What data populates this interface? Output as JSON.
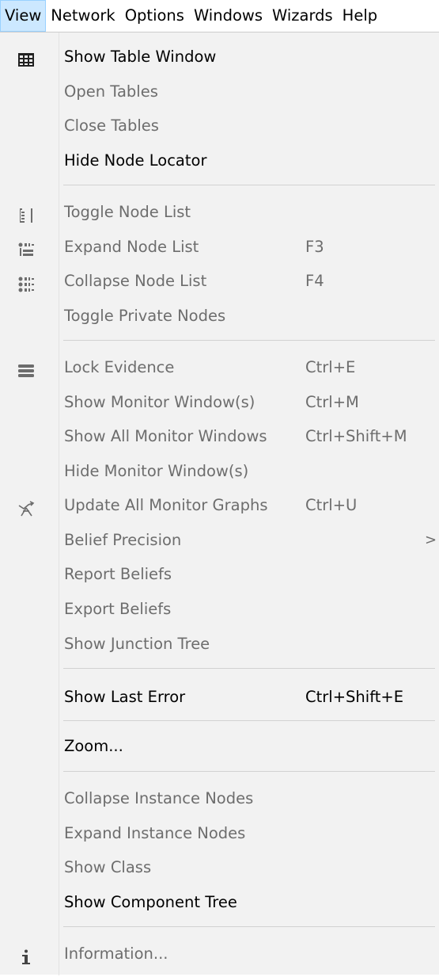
{
  "menubar": {
    "items": [
      "View",
      "Network",
      "Options",
      "Windows",
      "Wizards",
      "Help"
    ],
    "active": "View"
  },
  "menu": {
    "items": [
      {
        "label": "Show Table Window",
        "shortcut": "",
        "enabled": true,
        "icon": "table-icon"
      },
      {
        "label": "Open Tables",
        "shortcut": "",
        "enabled": false
      },
      {
        "label": "Close Tables",
        "shortcut": "",
        "enabled": false
      },
      {
        "label": "Hide Node Locator",
        "shortcut": "",
        "enabled": true
      },
      {
        "label": "Toggle Node List",
        "shortcut": "",
        "enabled": false,
        "icon": "node-list-icon"
      },
      {
        "label": "Expand Node List",
        "shortcut": "F3",
        "enabled": false,
        "icon": "expand-node-list-icon"
      },
      {
        "label": "Collapse Node List",
        "shortcut": "F4",
        "enabled": false,
        "icon": "collapse-node-list-icon"
      },
      {
        "label": "Toggle Private Nodes",
        "shortcut": "",
        "enabled": false
      },
      {
        "label": "Lock Evidence",
        "shortcut": "Ctrl+E",
        "enabled": false,
        "icon": "lock-evidence-icon"
      },
      {
        "label": "Show Monitor Window(s)",
        "shortcut": "Ctrl+M",
        "enabled": false
      },
      {
        "label": "Show All Monitor Windows",
        "shortcut": "Ctrl+Shift+M",
        "enabled": false
      },
      {
        "label": "Hide Monitor Window(s)",
        "shortcut": "",
        "enabled": false
      },
      {
        "label": "Update All Monitor Graphs",
        "shortcut": "Ctrl+U",
        "enabled": false,
        "icon": "update-graphs-icon"
      },
      {
        "label": "Belief Precision",
        "shortcut": "",
        "enabled": false,
        "submenu": true
      },
      {
        "label": "Report Beliefs",
        "shortcut": "",
        "enabled": false
      },
      {
        "label": "Export Beliefs",
        "shortcut": "",
        "enabled": false
      },
      {
        "label": "Show Junction Tree",
        "shortcut": "",
        "enabled": false
      },
      {
        "label": "Show Last Error",
        "shortcut": "Ctrl+Shift+E",
        "enabled": true
      },
      {
        "label": "Zoom...",
        "shortcut": "",
        "enabled": true
      },
      {
        "label": "Collapse Instance Nodes",
        "shortcut": "",
        "enabled": false
      },
      {
        "label": "Expand Instance Nodes",
        "shortcut": "",
        "enabled": false
      },
      {
        "label": "Show Class",
        "shortcut": "",
        "enabled": false
      },
      {
        "label": "Show Component Tree",
        "shortcut": "",
        "enabled": true
      },
      {
        "label": "Information...",
        "shortcut": "",
        "enabled": false,
        "icon": "info-icon"
      }
    ],
    "submenu_glyph": ">"
  },
  "colors": {
    "menu_bg": "#f2f2f2",
    "active_tab_bg": "#cce8ff",
    "enabled_text": "#000000",
    "disabled_text": "#6d6d6d",
    "separator": "#d2d2d2"
  }
}
